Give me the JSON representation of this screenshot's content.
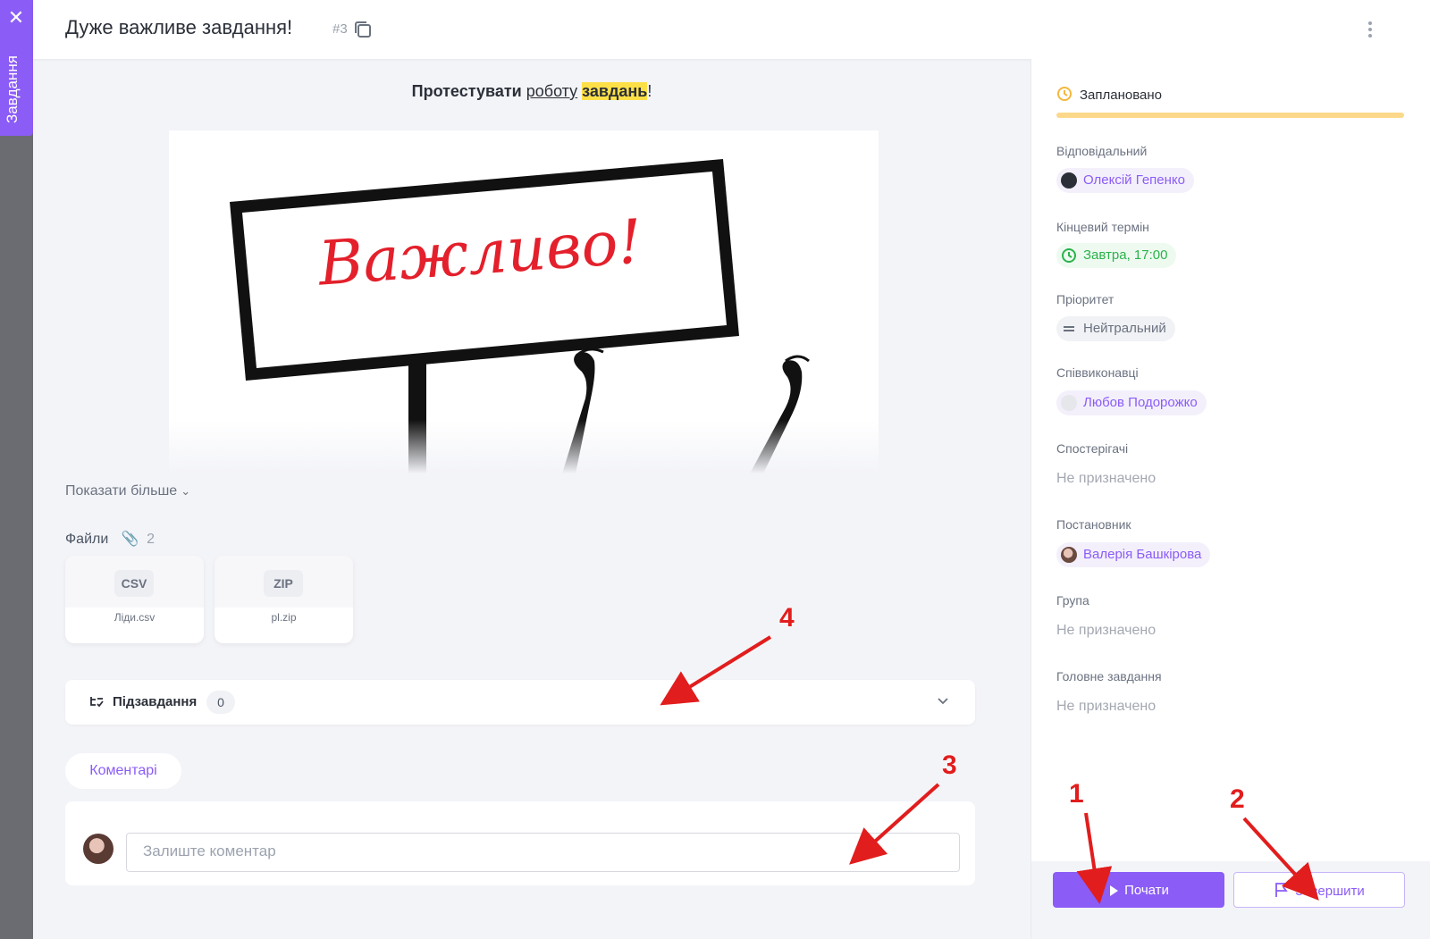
{
  "strip": {
    "label": "Завдання",
    "close_icon": "close-icon"
  },
  "header": {
    "title": "Дуже важливе завдання!",
    "task_number": "#3",
    "copy_icon": "copy-icon",
    "more_icon": "more-vertical-icon"
  },
  "description": {
    "part1": "Протестувати",
    "part2": "роботу",
    "part3": "завдань",
    "part4": "!"
  },
  "picture": {
    "sign_text": "Важливо!"
  },
  "show_more": "Показати більше",
  "files": {
    "title": "Файли",
    "count": "2",
    "items": [
      {
        "ext": "CSV",
        "name": "Ліди.csv"
      },
      {
        "ext": "ZIP",
        "name": "pl.zip"
      }
    ]
  },
  "subtasks": {
    "label": "Підзавдання",
    "count": "0"
  },
  "comments": {
    "tab": "Коментарі",
    "placeholder": "Залиште коментар"
  },
  "side": {
    "status": "Заплановано",
    "status_color": "#fcd98a",
    "status_progress": 1.0,
    "responsible_label": "Відповідальний",
    "responsible": "Олексій Гепенко",
    "deadline_label": "Кінцевий термін",
    "deadline": "Завтра, 17:00",
    "priority_label": "Пріоритет",
    "priority": "Нейтральний",
    "coexecutors_label": "Співвиконавці",
    "coexecutor": "Любов Подорожко",
    "observers_label": "Спостерігачі",
    "observers": "Не призначено",
    "creator_label": "Постановник",
    "creator": "Валерія Башкірова",
    "group_label": "Група",
    "group": "Не призначено",
    "parent_label": "Головне завдання",
    "parent": "Не призначено"
  },
  "buttons": {
    "start": "Почати",
    "finish": "Завершити"
  },
  "annotations": [
    "1",
    "2",
    "3",
    "4"
  ],
  "colors": {
    "accent": "#8b5cf6",
    "annotation": "#e11d1d",
    "deadline": "#2bb24c",
    "highlight": "#fde047"
  }
}
